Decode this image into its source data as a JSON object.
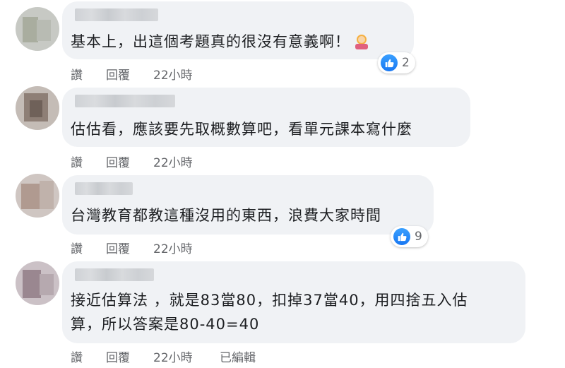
{
  "actions": {
    "like": "讚",
    "reply": "回覆",
    "edited": "已編輯"
  },
  "comments": [
    {
      "text": "基本上，出這個考題真的很沒有意義啊！",
      "emoji": "woman-gesturing-icon",
      "time": "22小時",
      "reactions": "2"
    },
    {
      "text": "估估看，應該要先取概數算吧，看單元課本寫什麼",
      "time": "22小時"
    },
    {
      "text": "台灣教育都教這種沒用的東西，浪費大家時間",
      "time": "22小時",
      "reactions": "9"
    },
    {
      "text_line1": "接近估算法 ，就是83當80，扣掉37當40，用四捨五入估",
      "text_line2": "算，所以答案是80-40=40",
      "time": "22小時"
    }
  ],
  "colors": {
    "bubble": "#f0f2f5",
    "like_blue": "#1877f2",
    "meta_gray": "#65676b"
  }
}
